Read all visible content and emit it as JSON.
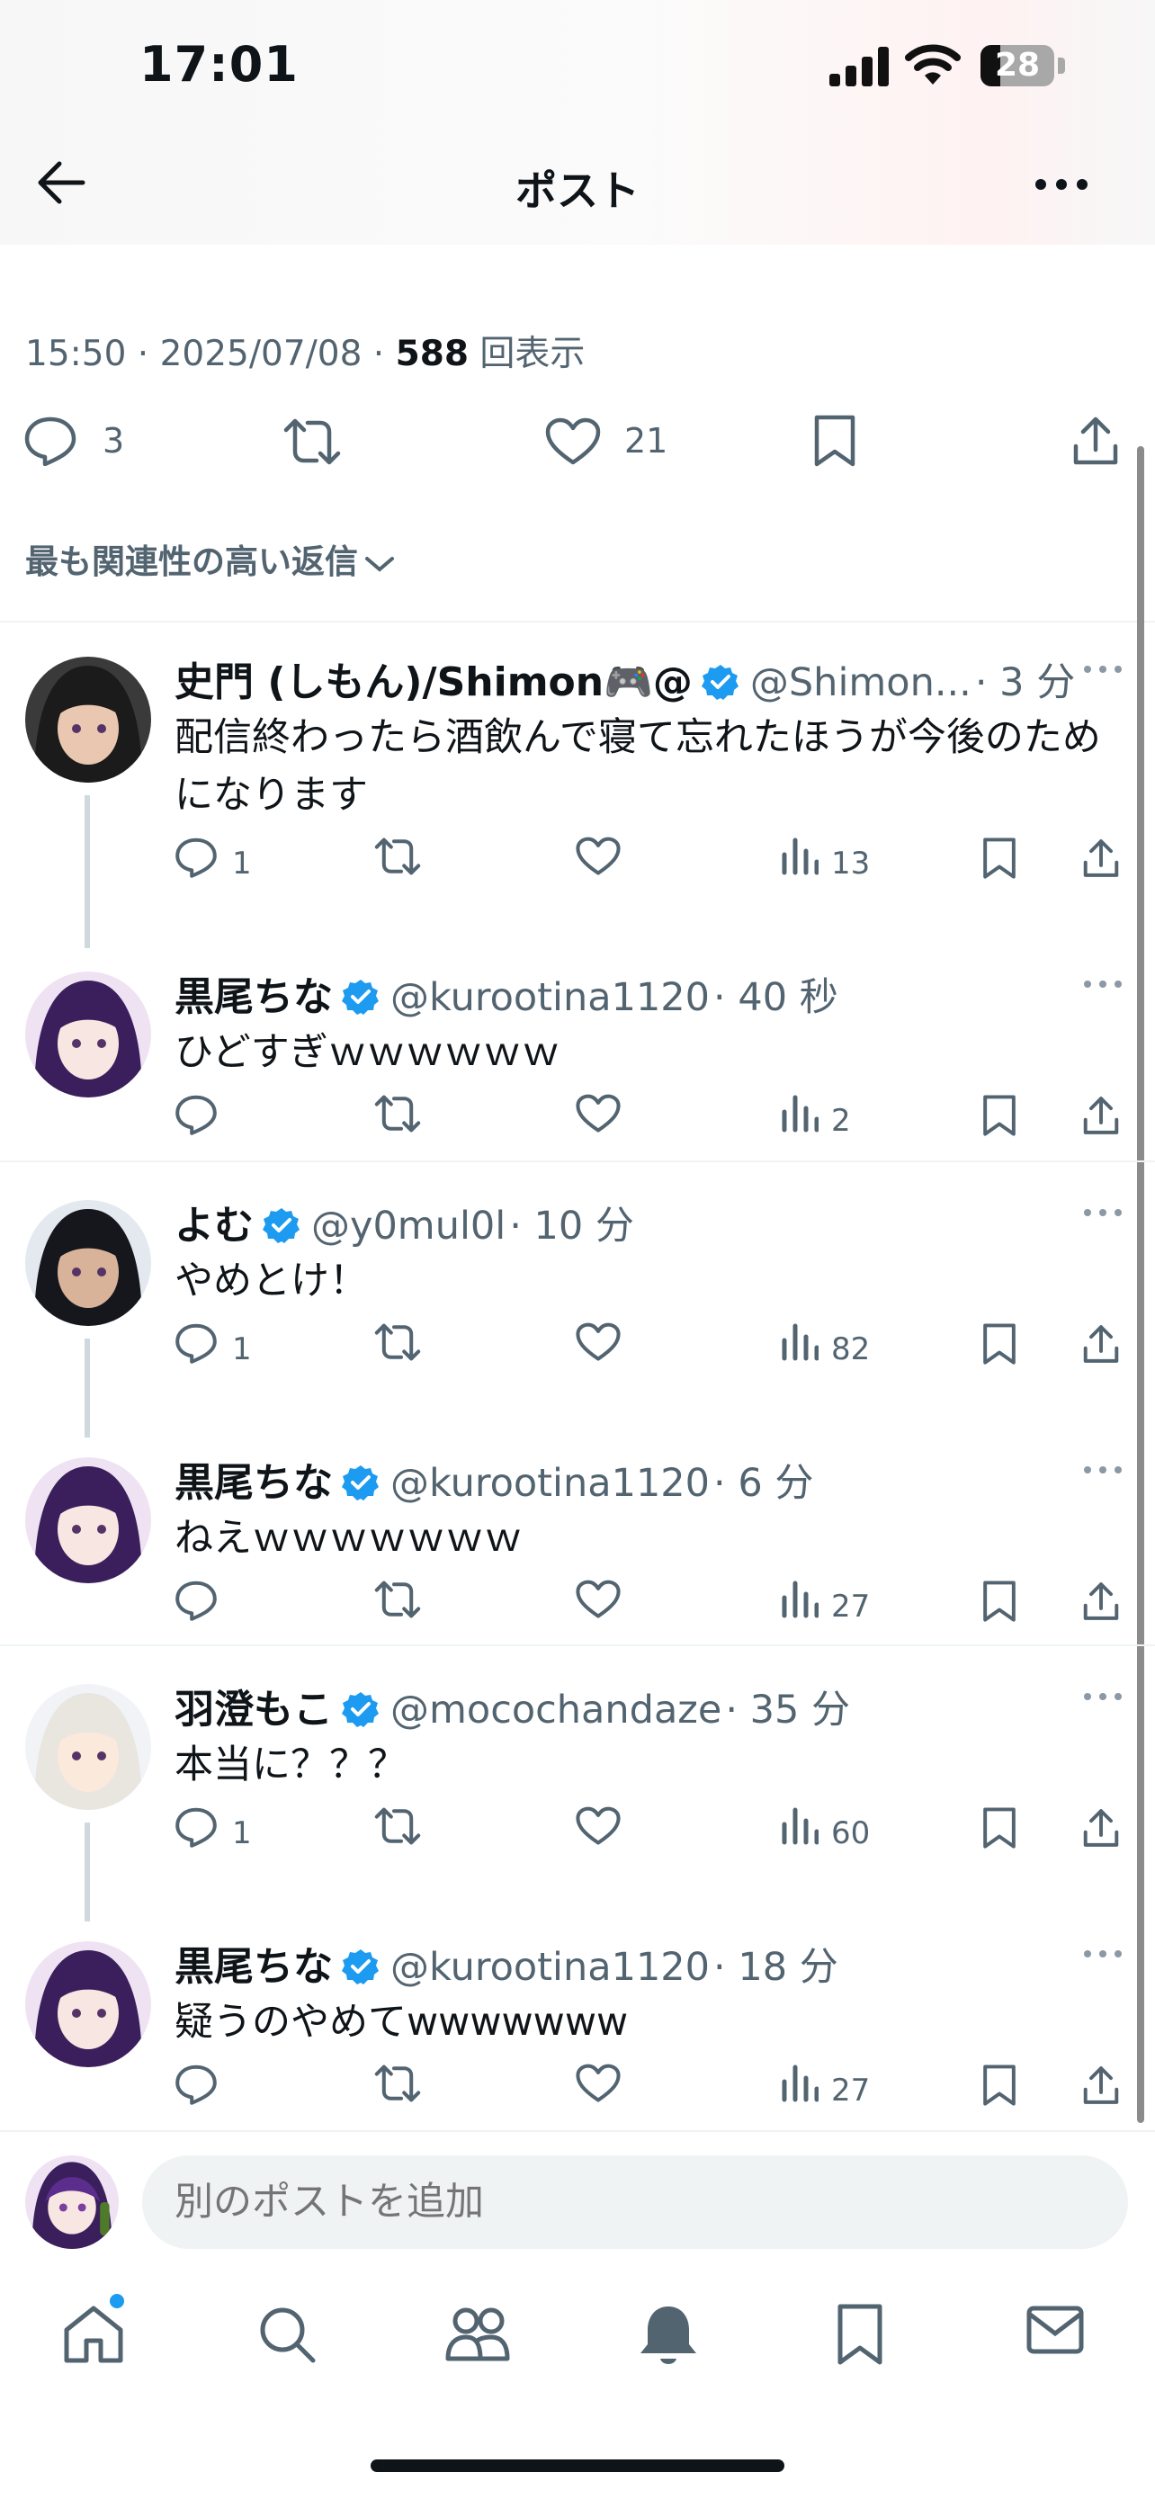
{
  "status_bar": {
    "time": "17:01",
    "battery": "28"
  },
  "header": {
    "title": "ポスト"
  },
  "post_meta": {
    "time": "15:50",
    "sep1": " · ",
    "date": "2025/07/08",
    "sep2": " · ",
    "views": "588",
    "views_label": " 回表示"
  },
  "post_actions": {
    "replies": "3",
    "likes": "21"
  },
  "sort_label": "最も関連性の高い返信",
  "replies": [
    {
      "name": "史門 (しもん)/Shimon🎮@",
      "handle": "@Shimon...",
      "time": "· 3 分",
      "text": "配信終わったら酒飲んで寝て忘れたほうが今後のためになります",
      "reply_count": "1",
      "views": "13"
    },
    {
      "name": "黒尾ちな",
      "handle": "@kurootina1120",
      "time": "· 40 秒",
      "text": "ひどすぎｗｗｗｗｗｗ",
      "reply_count": "",
      "views": "2"
    },
    {
      "name": "よむ",
      "handle": "@y0mul0l",
      "time": "· 10 分",
      "text": "やめとけ！",
      "reply_count": "1",
      "views": "82"
    },
    {
      "name": "黒尾ちな",
      "handle": "@kurootina1120",
      "time": "· 6 分",
      "text": "ねえｗｗｗｗｗｗｗ",
      "reply_count": "",
      "views": "27"
    },
    {
      "name": "羽澄もこ",
      "handle": "@mocochandaze",
      "time": "· 35 分",
      "text": "本当に？？？",
      "reply_count": "1",
      "views": "60"
    },
    {
      "name": "黒尾ちな",
      "handle": "@kurootina1120",
      "time": "· 18 分",
      "text": "疑うのやめてwwwwwww",
      "reply_count": "",
      "views": "27"
    }
  ],
  "composer": {
    "placeholder": "別のポストを追加"
  },
  "tabs": [
    "home-icon",
    "search-icon",
    "communities-icon",
    "notifications-icon",
    "bookmarks-icon",
    "messages-icon"
  ],
  "colors": {
    "verified": "#1d9bf0",
    "secondary_text": "#536471"
  }
}
